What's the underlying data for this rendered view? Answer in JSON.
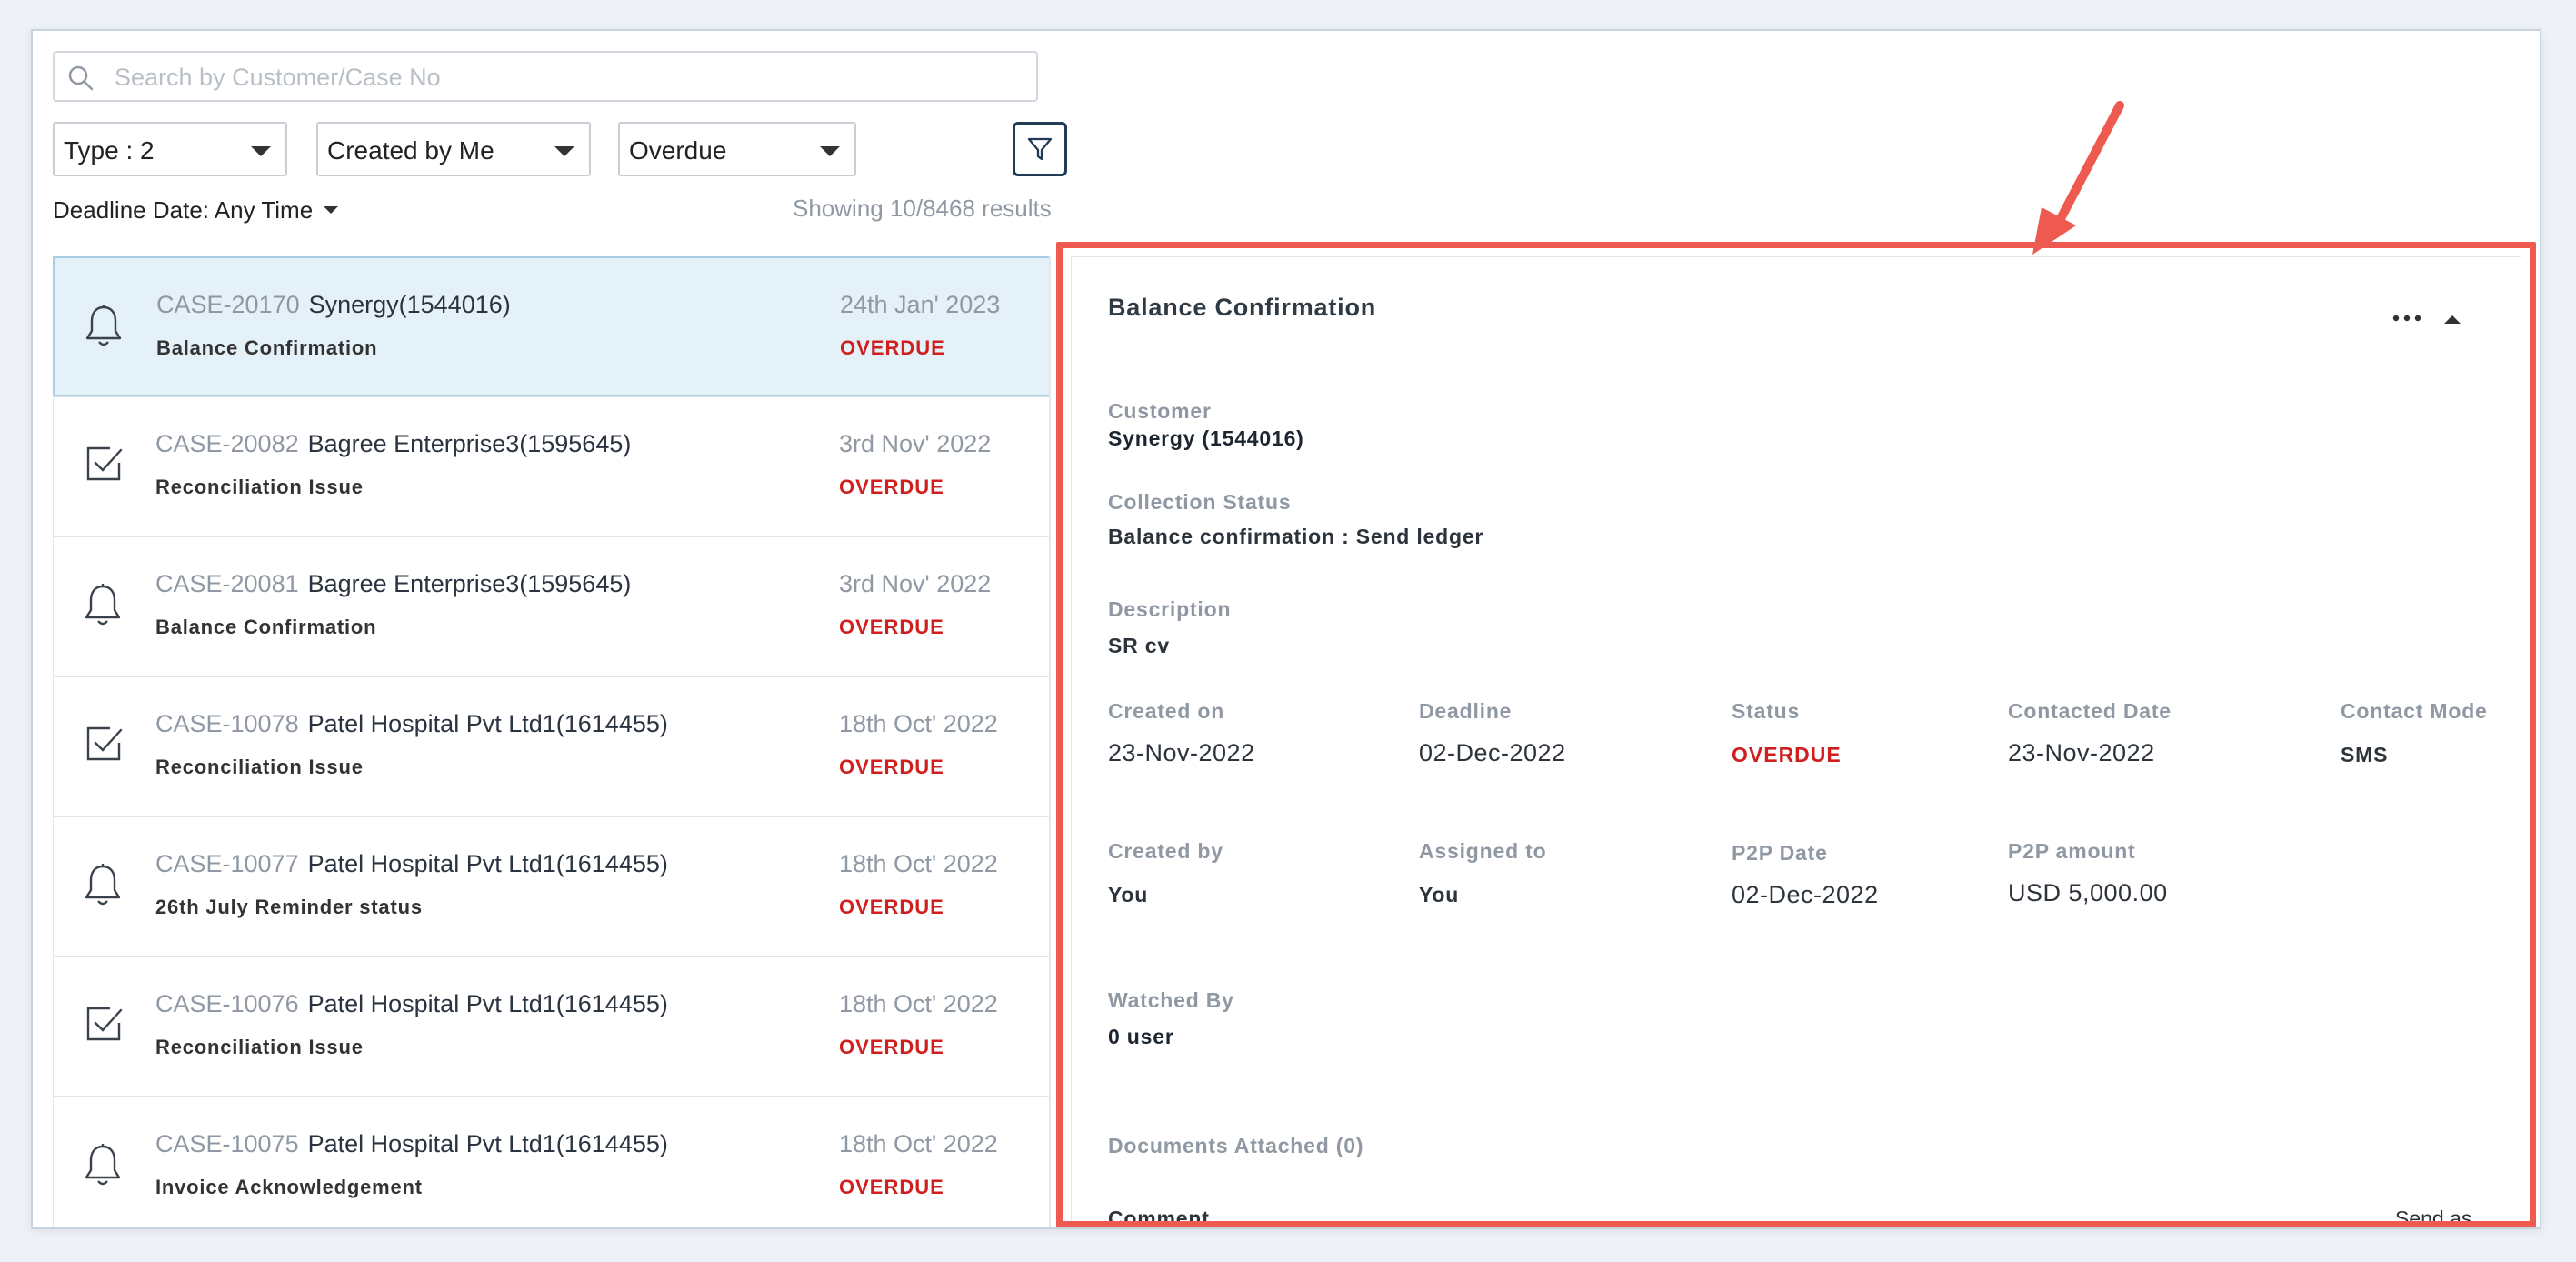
{
  "search": {
    "placeholder": "Search by Customer/Case No"
  },
  "filters": {
    "type_label": "Type : 2",
    "created_label": "Created by Me",
    "status_label": "Overdue",
    "deadline_label": "Deadline Date: Any Time",
    "results_text": "Showing 10/8468 results"
  },
  "cases": [
    {
      "id": "CASE-20170",
      "customer": "Synergy(1544016)",
      "type": "Balance Confirmation",
      "date": "24th Jan' 2023",
      "status": "OVERDUE",
      "icon": "bell-icon"
    },
    {
      "id": "CASE-20082",
      "customer": "Bagree Enterprise3(1595645)",
      "type": "Reconciliation Issue",
      "date": "3rd Nov' 2022",
      "status": "OVERDUE",
      "icon": "checkbox-icon"
    },
    {
      "id": "CASE-20081",
      "customer": "Bagree Enterprise3(1595645)",
      "type": "Balance Confirmation",
      "date": "3rd Nov' 2022",
      "status": "OVERDUE",
      "icon": "bell-icon"
    },
    {
      "id": "CASE-10078",
      "customer": "Patel Hospital Pvt Ltd1(1614455)",
      "type": "Reconciliation Issue",
      "date": "18th Oct' 2022",
      "status": "OVERDUE",
      "icon": "checkbox-icon"
    },
    {
      "id": "CASE-10077",
      "customer": "Patel Hospital Pvt Ltd1(1614455)",
      "type": "26th July Reminder status",
      "date": "18th Oct' 2022",
      "status": "OVERDUE",
      "icon": "bell-icon"
    },
    {
      "id": "CASE-10076",
      "customer": "Patel Hospital Pvt Ltd1(1614455)",
      "type": "Reconciliation Issue",
      "date": "18th Oct' 2022",
      "status": "OVERDUE",
      "icon": "checkbox-icon"
    },
    {
      "id": "CASE-10075",
      "customer": "Patel Hospital Pvt Ltd1(1614455)",
      "type": "Invoice Acknowledgement",
      "date": "18th Oct' 2022",
      "status": "OVERDUE",
      "icon": "bell-icon"
    }
  ],
  "detail": {
    "title": "Balance Confirmation",
    "customer_label": "Customer",
    "customer_value": "Synergy (1544016)",
    "collection_status_label": "Collection Status",
    "collection_status_value": "Balance confirmation : Send ledger",
    "description_label": "Description",
    "description_value": "SR cv",
    "created_on_label": "Created on",
    "created_on_value": "23-Nov-2022",
    "deadline_label": "Deadline",
    "deadline_value": "02-Dec-2022",
    "status_label": "Status",
    "status_value": "OVERDUE",
    "contacted_date_label": "Contacted Date",
    "contacted_date_value": "23-Nov-2022",
    "contact_mode_label": "Contact Mode",
    "contact_mode_value": "SMS",
    "created_by_label": "Created by",
    "created_by_value": "You",
    "assigned_to_label": "Assigned to",
    "assigned_to_value": "You",
    "p2p_date_label": "P2P Date",
    "p2p_date_value": "02-Dec-2022",
    "p2p_amount_label": "P2P amount",
    "p2p_amount_value": "USD 5,000.00",
    "watched_by_label": "Watched By",
    "watched_by_value": "0 user",
    "documents_label": "Documents Attached (0)",
    "comment_label": "Comment",
    "send_email_label": "Send as email"
  },
  "colors": {
    "overdue": "#cf1f1f",
    "highlight": "#ee5a4f",
    "selected_bg": "#e4f1f8",
    "filter_border": "#1f3b55"
  }
}
